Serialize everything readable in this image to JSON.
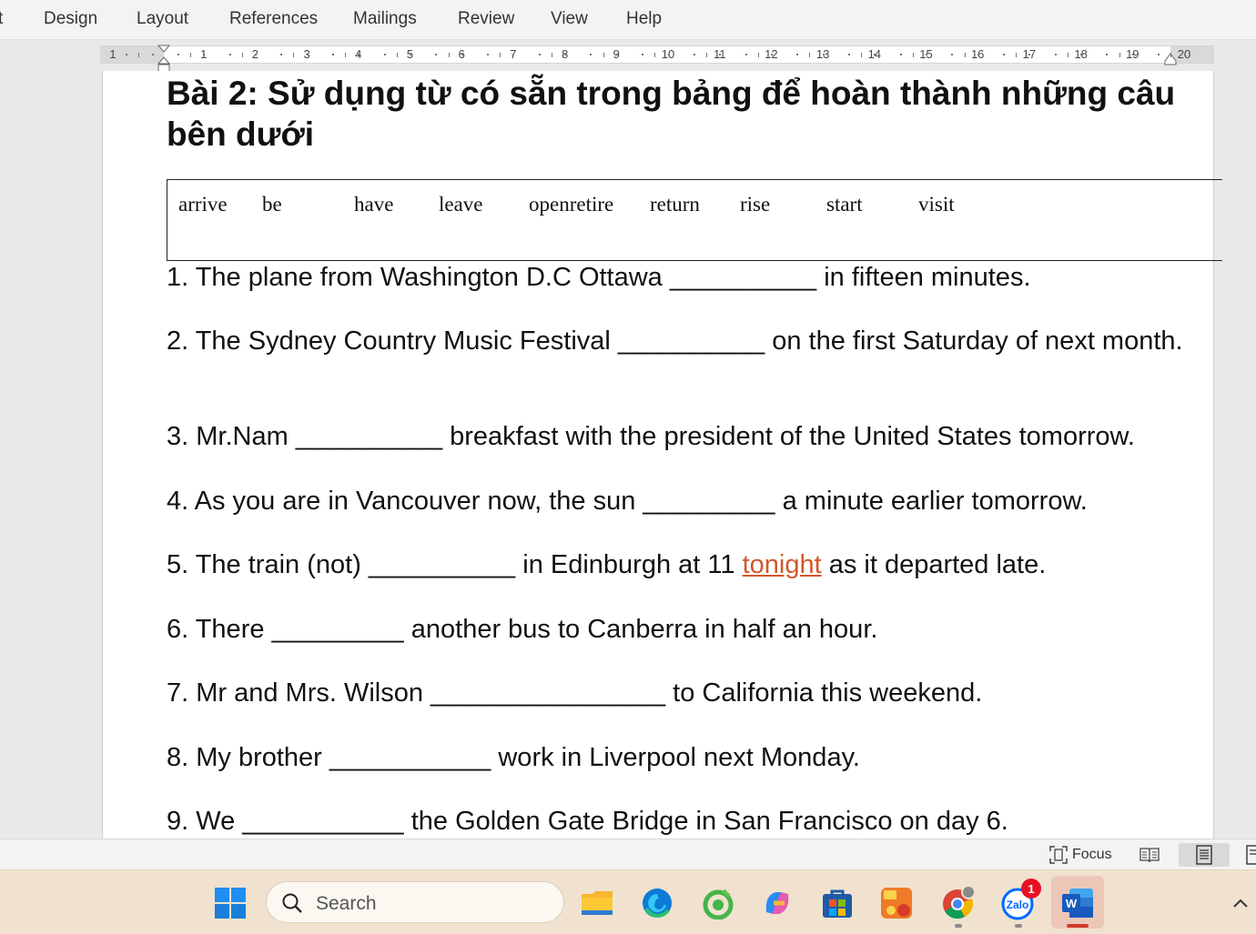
{
  "ribbon": {
    "tabs": [
      "t",
      "Design",
      "Layout",
      "References",
      "Mailings",
      "Review",
      "View",
      "Help"
    ]
  },
  "ruler": {
    "labels": [
      "1",
      "1",
      "2",
      "3",
      "4",
      "5",
      "6",
      "7",
      "8",
      "9",
      "10",
      "11",
      "12",
      "13",
      "14",
      "15",
      "16",
      "17",
      "18",
      "19",
      "20"
    ]
  },
  "document": {
    "heading": "Bài 2: Sử dụng từ có sẵn trong bảng để hoàn thành những câu  bên dưới",
    "word_bank": [
      "arrive",
      "be",
      "have",
      "leave",
      "openretire",
      "return",
      "rise",
      "start",
      "visit"
    ],
    "sentences": [
      {
        "text": "1. The plane from Washington D.C Ottawa __________ in fifteen minutes."
      },
      {
        "text": "2. The Sydney Country Music Festival __________ on the first Saturday of next month."
      },
      {
        "text": "3. Mr.Nam __________ breakfast with the president of the United States tomorrow."
      },
      {
        "text": "4. As you are in Vancouver now, the sun _________ a minute earlier tomorrow."
      },
      {
        "before": "5. The train (not) __________ in Edinburgh at 11 ",
        "flagged": "tonight",
        "after": " as it departed late."
      },
      {
        "text": "6. There _________ another bus to Canberra in half an hour."
      },
      {
        "text": "7. Mr and Mrs. Wilson ________________ to California this weekend."
      },
      {
        "text": "8. My brother ___________ work in Liverpool next Monday."
      },
      {
        "text": "9. We ___________ the Golden Gate Bridge in San Francisco on day 6."
      }
    ]
  },
  "statusbar": {
    "focus_label": "Focus",
    "focus_icon": "focus-icon",
    "views": [
      "read-mode-icon",
      "print-layout-icon",
      "web-layout-icon"
    ]
  },
  "taskbar": {
    "search_placeholder": "Search",
    "apps": [
      "windows-start-icon",
      "file-explorer-icon",
      "edge-icon",
      "coccoc-icon",
      "copilot-icon",
      "microsoft-store-icon",
      "my-bida-icon",
      "chrome-icon",
      "zalo-icon",
      "word-icon"
    ],
    "zalo_badge": "1",
    "tray": [
      "chevron-up-icon"
    ]
  },
  "colors": {
    "spell_error": "#d2572a",
    "taskbar_bg": "#f0e2cf",
    "word_blue": "#185abd"
  }
}
